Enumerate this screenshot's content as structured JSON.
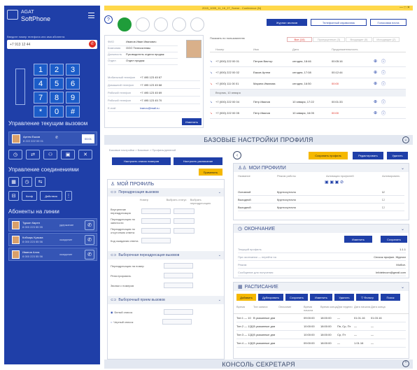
{
  "app": {
    "logo_line1": "AGAT",
    "logo_line2": "SoftPhone",
    "window_title": "2015_1009_11_16_27_Scene - Conference (N)"
  },
  "dialer": {
    "hint": "Введите номер телефона или имя абонента",
    "input_value": "+7 913 12 44",
    "keys": [
      "1",
      "2",
      "3",
      "4",
      "5",
      "6",
      "7",
      "8",
      "9",
      "*",
      "0",
      "#"
    ]
  },
  "sections": {
    "current_calls": "Управление текущим вызовом",
    "connections": "Управление соединениями",
    "line_subscribers": "Абоненты на линии"
  },
  "current_call": {
    "name": "Артем Ежков",
    "number": "8 222 222 00 01",
    "duration": "00:01"
  },
  "conn_buttons": {
    "mode": "Конф",
    "actions": "Действия"
  },
  "line_list": [
    {
      "name": "Туркин Карен",
      "number": "8 000 223 55 55",
      "status": "удержание"
    },
    {
      "name": "Кобзарь Кузьма",
      "number": "8 000 223 55 56",
      "status": "ожидание"
    },
    {
      "name": "Иванов Алла",
      "number": "8 000 223 55 56",
      "status": "ожидание"
    }
  ],
  "top_tabs": [
    "Журнал звонков",
    "Телефонный справочник",
    "Голосовая почта"
  ],
  "contact": {
    "rows": [
      {
        "label": "ФИО",
        "value": "Иванов Иван Иванович"
      },
      {
        "label": "Компания",
        "value": "ООО Телесистемы"
      },
      {
        "label": "Должность",
        "value": "Руководитель отдела продаж"
      },
      {
        "label": "Отдел",
        "value": "Отдел продаж"
      }
    ],
    "phones": [
      {
        "label": "Мобильный телефон",
        "value": "+7 495 123 45 67"
      },
      {
        "label": "Домашний телефон",
        "value": "+7 495 123 45 68"
      },
      {
        "label": "Рабочий телефон",
        "value": "+7 495 123 45 69"
      },
      {
        "label": "Рабочий телефон",
        "value": "+7 495 123 45 70"
      },
      {
        "label": "E-mail",
        "value": "ivanov@mail.ru"
      }
    ],
    "edit_btn": "Изменить"
  },
  "log": {
    "filter_label": "Показать по пользователю",
    "tabs": [
      "Все (10)",
      "Пропущенные (3)",
      "Входящие (5)",
      "Исходящие (2)"
    ],
    "cols": [
      "Номер",
      "Имя",
      "Дата",
      "Продолжительность"
    ],
    "rows": [
      {
        "num": "+7 (000) 222 00 01",
        "name": "Петров Виктор",
        "date": "сегодня, 18:46",
        "dur": "00:05:16"
      },
      {
        "num": "+7 (000) 222 00 02",
        "name": "Ежков Артем",
        "date": "сегодня, 17:08",
        "dur": "00:12:44"
      },
      {
        "num": "+7 (000) 111 00 01",
        "name": "Маринa Иванова",
        "date": "сегодня, 16:50",
        "dur": "00:00"
      }
    ],
    "group": "Вторник, 10 января",
    "rows2": [
      {
        "num": "+7 (000) 222 00 04",
        "name": "Петр Иванов",
        "date": "10 января, 17:22",
        "dur": "00:01:33"
      },
      {
        "num": "+7 (000) 222 00 05",
        "name": "Петр Иванов",
        "date": "10 января, 16:05",
        "dur": "00:00"
      }
    ]
  },
  "bar_profile": "БАЗОВЫЕ НАСТРОЙКИ ПРОФИЛЯ",
  "bar_console": "КОНСОЛЬ СЕКРЕТАРЯ",
  "profile": {
    "breadcrumb": "Базовые настройки > Базовые > Профиль/дневной",
    "btn_calls": "Настроить список номеров",
    "btn_schedule": "Настроить расписание",
    "btn_apply": "Применить",
    "title": "МОЙ ПРОФИЛЬ",
    "forward_title": "Переадресация вызовов",
    "forward_cols": [
      "Номер",
      "Выбрать статус",
      "Выбрать переадресацию"
    ],
    "forward_rows": [
      "Внутренние переадресация",
      "Переадресация по занятости",
      "Переадресация по отсутствию ответа",
      "Код ожидания ответа"
    ],
    "selective_title": "Выборочная переадресация вызовов",
    "selective_rows": [
      "Переадресация на номер",
      "Регистрировать",
      "Звонки с номеров"
    ],
    "receive_title": "Выборочный прием вызовов",
    "receive_rows": [
      "Белый список",
      "Черный список"
    ]
  },
  "right": {
    "btn_save_profile": "Сохранить профиль",
    "btn_edit": "Редактировать",
    "btn_delete": "Удалить",
    "profiles_title": "МОИ ПРОФИЛИ",
    "profiles_cols": [
      "Название",
      "Режим работы",
      "Активация профилей",
      "Активировать"
    ],
    "profiles_rows": [
      {
        "name": "Основной",
        "mode": "Круглосуточно"
      },
      {
        "name": "Выходной",
        "mode": "Круглосуточно"
      },
      {
        "name": "Выходной",
        "mode": "Круглосуточно"
      }
    ],
    "expire_title": "ОКОНЧАНИЕ",
    "expire_btn_change": "Изменить",
    "expire_btn_save": "Сохранить",
    "expire_rows": [
      {
        "label": "Текущий профиль",
        "value": "1.1.1"
      },
      {
        "label": "При окончании — перейти на",
        "value": "Список профил. Журнал"
      },
      {
        "label": "Режим",
        "value": "Мобил."
      },
      {
        "label": "Сообщение для получения",
        "value": "Infotelecom@gmail.com"
      }
    ],
    "schedule_title": "РАСПИСАНИЕ",
    "schedule_btns": [
      "Добавить",
      "Дублировать",
      "Сохранить",
      "Изменить",
      "Удалить",
      "Фильтр",
      "Поиск"
    ],
    "schedule_cols": [
      "Время",
      "Тип записи",
      "Описание",
      "Время начала",
      "Время конца",
      "Дни недели",
      "Дата начала",
      "Дата конца"
    ],
    "schedule_rows": [
      {
        "time": "Тип 1 — 10",
        "type": "В указанные дни",
        "start": "09:00:00",
        "end": "18:00:00",
        "days": "—",
        "d1": "01.01.16",
        "d2": "01.03.16"
      },
      {
        "time": "Тип 2 — 12Д",
        "type": "В указанные дни",
        "start": "10:00:00",
        "end": "18:00:00",
        "days": "Пн, Ср, Пт",
        "d1": "—",
        "d2": "—"
      },
      {
        "time": "Тип 3 — 12Д",
        "type": "В указанные дни",
        "start": "10:00:00",
        "end": "18:00:00",
        "days": "Ср, Пт",
        "d1": "—",
        "d2": "—"
      },
      {
        "time": "Тип 4 — 12Д",
        "type": "В указанные дни",
        "start": "09:00:00",
        "end": "18:00:00",
        "days": "—",
        "d1": "1.01.16",
        "d2": "—"
      }
    ]
  },
  "colors": {
    "brand": "#1f3fa8",
    "accent": "#f5b800",
    "call_red": "#e02b20"
  },
  "icons": {
    "menu": "hamburger-icon",
    "phone": "phone-icon",
    "help": "help-icon"
  }
}
